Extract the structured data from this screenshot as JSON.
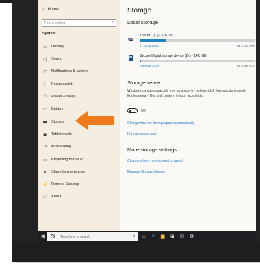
{
  "sidebar": {
    "home_label": "Home",
    "search_placeholder": "Find a setting",
    "section": "System",
    "items": [
      {
        "label": "Display",
        "icon": "display-icon"
      },
      {
        "label": "Sound",
        "icon": "speaker-icon"
      },
      {
        "label": "Notifications & actions",
        "icon": "notification-icon"
      },
      {
        "label": "Focus assist",
        "icon": "moon-icon"
      },
      {
        "label": "Power & sleep",
        "icon": "power-icon"
      },
      {
        "label": "Battery",
        "icon": "battery-icon"
      },
      {
        "label": "Storage",
        "icon": "storage-icon"
      },
      {
        "label": "Tablet mode",
        "icon": "tablet-icon"
      },
      {
        "label": "Multitasking",
        "icon": "multitask-icon"
      },
      {
        "label": "Projecting to this PC",
        "icon": "project-icon"
      },
      {
        "label": "Shared experiences",
        "icon": "shared-icon"
      },
      {
        "label": "Remote Desktop",
        "icon": "remote-icon"
      },
      {
        "label": "About",
        "icon": "info-icon"
      }
    ],
    "selected": "Storage"
  },
  "main": {
    "title": "Storage",
    "local_heading": "Local storage",
    "drives": [
      {
        "name": "This PC (C:) - 118 GB",
        "used": "27.6 GB used",
        "free": "91.2 GB free",
        "fill": 0.23
      },
      {
        "name": "Secure Digital storage device (D:) - 14.8 GB",
        "used": "7.80 MB used",
        "free": "14.8 GB free",
        "fill": 0.01
      }
    ],
    "sense_heading": "Storage sense",
    "sense_text": "Windows can automatically free up space by getting rid of files you don't need, like temporary files and content in your recycle bin.",
    "toggle_label": "Off",
    "links": [
      "Change how we free up space automatically",
      "Free up space now"
    ],
    "more_heading": "More storage settings",
    "more_links": [
      "Change where new content is saved",
      "Manage Storage Spaces"
    ]
  },
  "taskbar": {
    "search_placeholder": "Type here to search"
  },
  "colors": {
    "accent": "#1f84c6",
    "arrow": "#f07b1a",
    "sidebar_bg": "#f5eee0"
  }
}
